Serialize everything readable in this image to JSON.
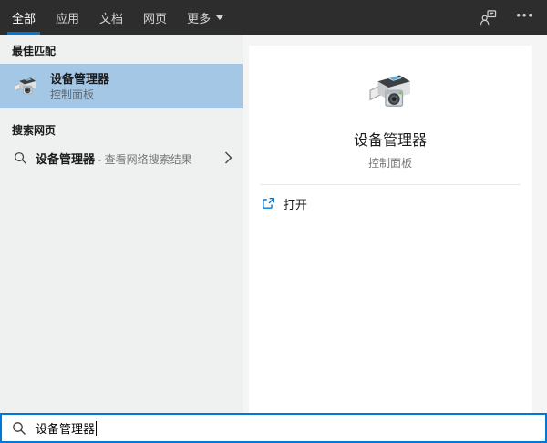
{
  "topbar": {
    "tabs": [
      {
        "label": "全部",
        "active": true
      },
      {
        "label": "应用",
        "active": false
      },
      {
        "label": "文档",
        "active": false
      },
      {
        "label": "网页",
        "active": false
      },
      {
        "label": "更多",
        "active": false,
        "has_dropdown": true
      }
    ]
  },
  "left_panel": {
    "best_match_header": "最佳匹配",
    "best_match_item": {
      "title": "设备管理器",
      "subtitle": "控制面板"
    },
    "web_search_header": "搜索网页",
    "web_search_item": {
      "query": "设备管理器",
      "hint": " - 查看网络搜索结果"
    }
  },
  "detail_panel": {
    "title": "设备管理器",
    "subtitle": "控制面板",
    "open_label": "打开"
  },
  "search_bar": {
    "value": "设备管理器"
  },
  "colors": {
    "accent": "#0078d7",
    "topbar_bg": "#2d2d2d",
    "highlight_row": "#a4c7e6",
    "left_pane_bg": "#eff0f0",
    "open_icon": "#0078d7",
    "led_green": "#7dc242"
  }
}
